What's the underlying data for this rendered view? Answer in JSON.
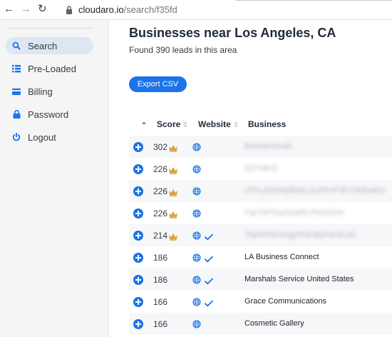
{
  "browser": {
    "url_host": "cloudaro.io",
    "url_path": "/search/f35fd"
  },
  "sidebar": {
    "items": [
      {
        "label": "Search",
        "icon": "search-icon",
        "active": true
      },
      {
        "label": "Pre-Loaded",
        "icon": "list-icon",
        "active": false
      },
      {
        "label": "Billing",
        "icon": "credit-card-icon",
        "active": false
      },
      {
        "label": "Password",
        "icon": "lock-icon",
        "active": false
      },
      {
        "label": "Logout",
        "icon": "power-icon",
        "active": false
      }
    ]
  },
  "main": {
    "title": "Businesses near Los Angeles, CA",
    "subtitle": "Found 390 leads in this area",
    "export_label": "Export CSV",
    "columns": {
      "score": "Score",
      "website": "Website",
      "business": "Business"
    },
    "rows": [
      {
        "score": "302",
        "crown": true,
        "has_website": true,
        "verified": false,
        "business": "Bunkerclouds",
        "blurred": true
      },
      {
        "score": "226",
        "crown": true,
        "has_website": true,
        "verified": false,
        "business": "EDTMKS",
        "blurred": true
      },
      {
        "score": "226",
        "crown": true,
        "has_website": true,
        "verified": false,
        "business": "cPFuJDNMyBNbLGuRPvPJbYSKlkwiNJ",
        "blurred": true
      },
      {
        "score": "226",
        "crown": true,
        "has_website": true,
        "verified": false,
        "business": "FqnTkPQaclucbRLPtGOZeh",
        "blurred": true
      },
      {
        "score": "214",
        "crown": true,
        "has_website": true,
        "verified": true,
        "business": "TkpNHNrmngyRHiUByhandLeD",
        "blurred": true
      },
      {
        "score": "186",
        "crown": false,
        "has_website": true,
        "verified": true,
        "business": "LA Business Connect",
        "blurred": false
      },
      {
        "score": "186",
        "crown": false,
        "has_website": true,
        "verified": true,
        "business": "Marshals Service United States",
        "blurred": false
      },
      {
        "score": "166",
        "crown": false,
        "has_website": true,
        "verified": true,
        "business": "Grace Communications",
        "blurred": false
      },
      {
        "score": "166",
        "crown": false,
        "has_website": true,
        "verified": false,
        "business": "Cosmetic Gallery",
        "blurred": false
      }
    ]
  },
  "colors": {
    "accent": "#1a73e8",
    "crown": "#d9a441",
    "sidebar_active": "#dde6f3"
  }
}
